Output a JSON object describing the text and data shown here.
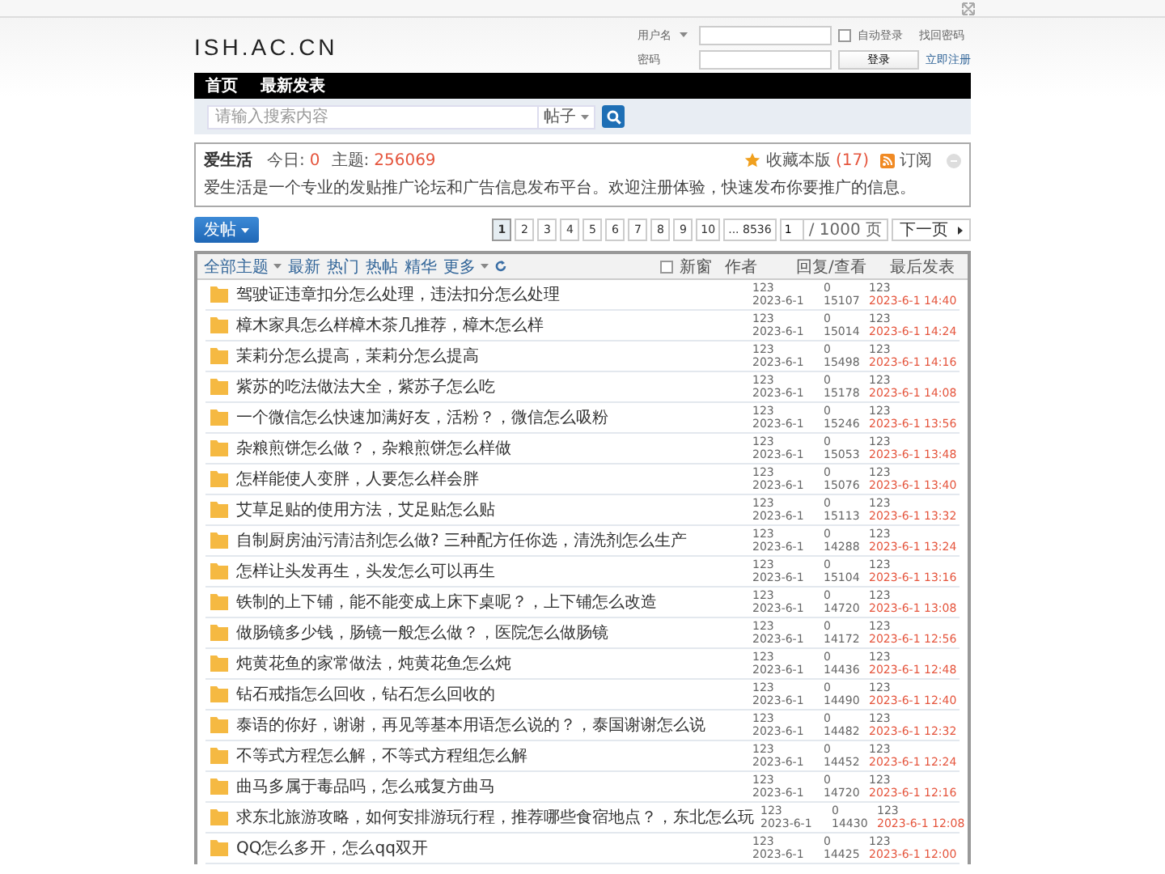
{
  "header": {
    "logo": "ISH.AC.CN",
    "login": {
      "username_label": "用户名",
      "password_label": "密码",
      "auto_login": {
        "label": "自动登录",
        "checked": false
      },
      "forgot": "找回密码",
      "login_button": "登录",
      "register": "立即注册"
    }
  },
  "nav": {
    "items": [
      "首页",
      "最新发表"
    ]
  },
  "search": {
    "placeholder": "请输入搜索内容",
    "scope": "帖子"
  },
  "forum": {
    "name": "爱生活",
    "today_label": "今日:",
    "today": "0",
    "threads_label": "主题:",
    "threads": "256069",
    "favorite": "收藏本版",
    "favorite_count": "(17)",
    "subscribe": "订阅",
    "description": "爱生活是一个专业的发贴推广论坛和广告信息发布平台。欢迎注册体验，快速发布你要推广的信息。"
  },
  "post_button": "发帖",
  "pagination": {
    "pages": [
      {
        "label": "1",
        "selected": true
      },
      {
        "label": "2",
        "selected": false
      },
      {
        "label": "3",
        "selected": false
      },
      {
        "label": "4",
        "selected": false
      },
      {
        "label": "5",
        "selected": false
      },
      {
        "label": "6",
        "selected": false
      },
      {
        "label": "7",
        "selected": false
      },
      {
        "label": "8",
        "selected": false
      },
      {
        "label": "9",
        "selected": false
      },
      {
        "label": "10",
        "selected": false
      },
      {
        "label": "... 8536",
        "selected": false
      }
    ],
    "page_input": "1",
    "total": "/ 1000 页",
    "next": "下一页"
  },
  "filters": {
    "items": [
      {
        "label": "全部主题",
        "kind": "dropdown"
      },
      {
        "label": "最新",
        "kind": "link"
      },
      {
        "label": "热门",
        "kind": "link"
      },
      {
        "label": "热帖",
        "kind": "link"
      },
      {
        "label": "精华",
        "kind": "link"
      },
      {
        "label": "更多",
        "kind": "dropdown"
      }
    ],
    "new_window": {
      "label": "新窗",
      "checked": false
    },
    "columns": [
      "作者",
      "回复/查看",
      "最后发表"
    ]
  },
  "threads": [
    {
      "title": "驾驶证违章扣分怎么处理，违法扣分怎么处理",
      "author": "123",
      "date": "2023-6-1",
      "replies": "0",
      "views": "15107",
      "last_author": "123",
      "last_time": "2023-6-1 14:40"
    },
    {
      "title": "樟木家具怎么样樟木茶几推荐，樟木怎么样",
      "author": "123",
      "date": "2023-6-1",
      "replies": "0",
      "views": "15014",
      "last_author": "123",
      "last_time": "2023-6-1 14:24"
    },
    {
      "title": "茉莉分怎么提高，茉莉分怎么提高",
      "author": "123",
      "date": "2023-6-1",
      "replies": "0",
      "views": "15498",
      "last_author": "123",
      "last_time": "2023-6-1 14:16"
    },
    {
      "title": "紫苏的吃法做法大全，紫苏子怎么吃",
      "author": "123",
      "date": "2023-6-1",
      "replies": "0",
      "views": "15178",
      "last_author": "123",
      "last_time": "2023-6-1 14:08"
    },
    {
      "title": "一个微信怎么快速加满好友，活粉？，微信怎么吸粉",
      "author": "123",
      "date": "2023-6-1",
      "replies": "0",
      "views": "15246",
      "last_author": "123",
      "last_time": "2023-6-1 13:56"
    },
    {
      "title": "杂粮煎饼怎么做？，杂粮煎饼怎么样做",
      "author": "123",
      "date": "2023-6-1",
      "replies": "0",
      "views": "15053",
      "last_author": "123",
      "last_time": "2023-6-1 13:48"
    },
    {
      "title": "怎样能使人变胖，人要怎么样会胖",
      "author": "123",
      "date": "2023-6-1",
      "replies": "0",
      "views": "15076",
      "last_author": "123",
      "last_time": "2023-6-1 13:40"
    },
    {
      "title": "艾草足贴的使用方法，艾足贴怎么贴",
      "author": "123",
      "date": "2023-6-1",
      "replies": "0",
      "views": "15113",
      "last_author": "123",
      "last_time": "2023-6-1 13:32"
    },
    {
      "title": "自制厨房油污清洁剂怎么做? 三种配方任你选，清洗剂怎么生产",
      "author": "123",
      "date": "2023-6-1",
      "replies": "0",
      "views": "14288",
      "last_author": "123",
      "last_time": "2023-6-1 13:24"
    },
    {
      "title": "怎样让头发再生，头发怎么可以再生",
      "author": "123",
      "date": "2023-6-1",
      "replies": "0",
      "views": "15104",
      "last_author": "123",
      "last_time": "2023-6-1 13:16"
    },
    {
      "title": "铁制的上下铺，能不能变成上床下桌呢？，上下铺怎么改造",
      "author": "123",
      "date": "2023-6-1",
      "replies": "0",
      "views": "14720",
      "last_author": "123",
      "last_time": "2023-6-1 13:08"
    },
    {
      "title": "做肠镜多少钱，肠镜一般怎么做？，医院怎么做肠镜",
      "author": "123",
      "date": "2023-6-1",
      "replies": "0",
      "views": "14172",
      "last_author": "123",
      "last_time": "2023-6-1 12:56"
    },
    {
      "title": "炖黄花鱼的家常做法，炖黄花鱼怎么炖",
      "author": "123",
      "date": "2023-6-1",
      "replies": "0",
      "views": "14436",
      "last_author": "123",
      "last_time": "2023-6-1 12:48"
    },
    {
      "title": "钻石戒指怎么回收，钻石怎么回收的",
      "author": "123",
      "date": "2023-6-1",
      "replies": "0",
      "views": "14490",
      "last_author": "123",
      "last_time": "2023-6-1 12:40"
    },
    {
      "title": "泰语的你好，谢谢，再见等基本用语怎么说的？，泰国谢谢怎么说",
      "author": "123",
      "date": "2023-6-1",
      "replies": "0",
      "views": "14482",
      "last_author": "123",
      "last_time": "2023-6-1 12:32"
    },
    {
      "title": "不等式方程怎么解，不等式方程组怎么解",
      "author": "123",
      "date": "2023-6-1",
      "replies": "0",
      "views": "14452",
      "last_author": "123",
      "last_time": "2023-6-1 12:24"
    },
    {
      "title": "曲马多属于毒品吗，怎么戒复方曲马",
      "author": "123",
      "date": "2023-6-1",
      "replies": "0",
      "views": "14720",
      "last_author": "123",
      "last_time": "2023-6-1 12:16"
    },
    {
      "title": "求东北旅游攻略，如何安排游玩行程，推荐哪些食宿地点？，东北怎么玩",
      "author": "123",
      "date": "2023-6-1",
      "replies": "0",
      "views": "14430",
      "last_author": "123",
      "last_time": "2023-6-1 12:08"
    },
    {
      "title": "QQ怎么多开，怎么qq双开",
      "author": "123",
      "date": "2023-6-1",
      "replies": "0",
      "views": "14425",
      "last_author": "123",
      "last_time": "2023-6-1 12:00"
    }
  ]
}
